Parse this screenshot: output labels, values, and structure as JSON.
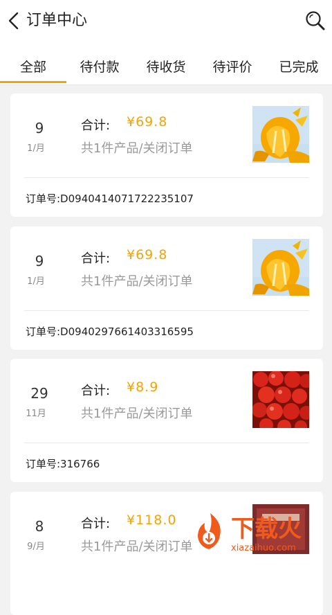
{
  "header": {
    "title": "订单中心",
    "back_icon": "chevron-left-icon",
    "search_icon": "search-icon"
  },
  "tabs": [
    {
      "label": "全部",
      "active": true
    },
    {
      "label": "待付款",
      "active": false
    },
    {
      "label": "待收货",
      "active": false
    },
    {
      "label": "待评价",
      "active": false
    },
    {
      "label": "已完成",
      "active": false
    }
  ],
  "colors": {
    "accent": "#f5a300",
    "background": "#f2f2f2",
    "card": "#ffffff",
    "muted_text": "#999999"
  },
  "orders": [
    {
      "day": "9",
      "month": "1/月",
      "total_label": "合计:",
      "total": "¥69.8",
      "summary": "共1件产品/关闭订单",
      "order_no": "订单号:D0940414071722235107",
      "thumb": "orange"
    },
    {
      "day": "9",
      "month": "1/月",
      "total_label": "合计:",
      "total": "¥69.8",
      "summary": "共1件产品/关闭订单",
      "order_no": "订单号:D0940297661403316595",
      "thumb": "orange"
    },
    {
      "day": "29",
      "month": "11月",
      "total_label": "合计:",
      "total": "¥8.9",
      "summary": "共1件产品/关闭订单",
      "order_no": "订单号:316766",
      "thumb": "tomato"
    },
    {
      "day": "8",
      "month": "9/月",
      "total_label": "合计:",
      "total": "¥118.0",
      "summary": "共1件产品/关闭订单",
      "order_no": "",
      "thumb": "box"
    }
  ],
  "watermark": {
    "text": "下载火",
    "subtext": "xiazaihuo.com"
  }
}
